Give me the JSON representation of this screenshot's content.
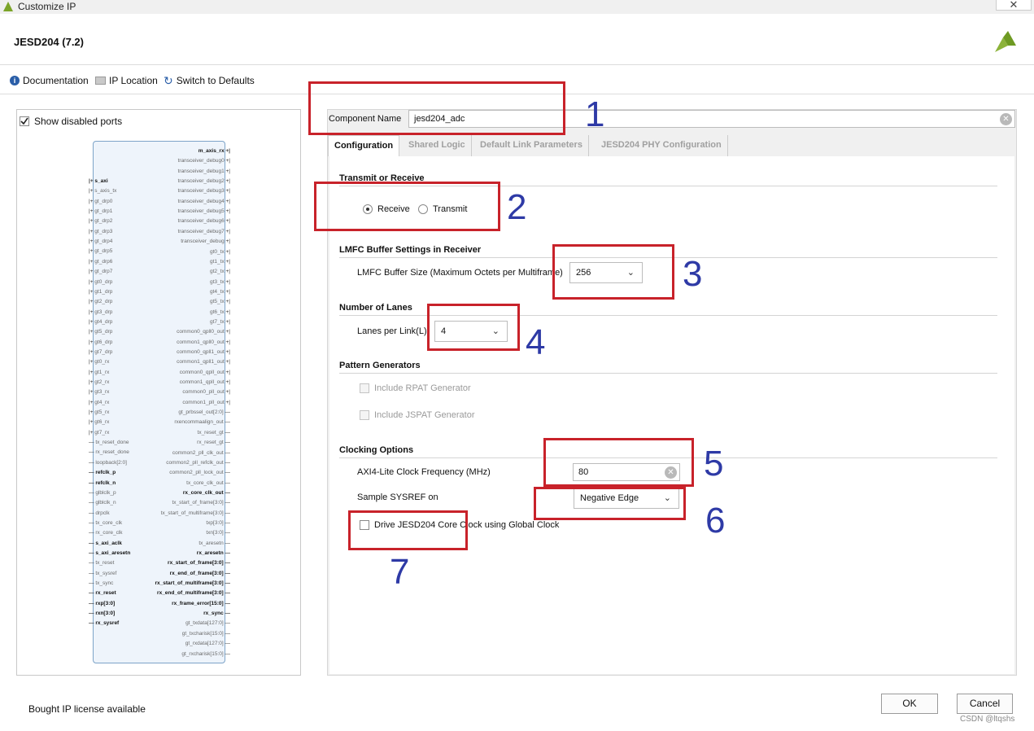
{
  "window": {
    "title": "Customize IP",
    "close_glyph": "✕"
  },
  "header": {
    "ip_name": "JESD204 (7.2)"
  },
  "toolbar": {
    "documentation": "Documentation",
    "ip_location": "IP Location",
    "switch_defaults": "Switch to Defaults"
  },
  "left_panel": {
    "show_disabled_ports": "Show disabled ports",
    "left_ports": [
      "s_axi",
      "s_axis_tx",
      "gt_drp0",
      "gt_drp1",
      "gt_drp2",
      "gt_drp3",
      "gt_drp4",
      "gt_drp5",
      "gt_drp6",
      "gt_drp7",
      "gt0_drp",
      "gt1_drp",
      "gt2_drp",
      "gt3_drp",
      "gt4_drp",
      "gt5_drp",
      "gt6_drp",
      "gt7_drp",
      "gt0_rx",
      "gt1_rx",
      "gt2_rx",
      "gt3_rx",
      "gt4_rx",
      "gt5_rx",
      "gt6_rx",
      "gt7_rx",
      "tx_reset_done",
      "rx_reset_done",
      "loopback[2:0]",
      "refclk_p",
      "refclk_n",
      "glblclk_p",
      "glblclk_n",
      "drpclk",
      "tx_core_clk",
      "rx_core_clk",
      "s_axi_aclk",
      "s_axi_aresetn",
      "tx_reset",
      "tx_sysref",
      "tx_sync",
      "rx_reset",
      "rxp[3:0]",
      "rxn[3:0]",
      "rx_sysref"
    ],
    "right_ports": [
      "m_axis_rx",
      "transceiver_debug0",
      "transceiver_debug1",
      "transceiver_debug2",
      "transceiver_debug3",
      "transceiver_debug4",
      "transceiver_debug5",
      "transceiver_debug6",
      "transceiver_debug7",
      "transceiver_debug",
      "gt0_tx",
      "gt1_tx",
      "gt2_tx",
      "gt3_tx",
      "gt4_tx",
      "gt5_tx",
      "gt6_tx",
      "gt7_tx",
      "common0_qpll0_out",
      "common1_qpll0_out",
      "common0_qpll1_out",
      "common1_qpll1_out",
      "common0_qpll_out",
      "common1_qpll_out",
      "common0_pll_out",
      "common1_pll_out",
      "gt_prbssel_out[2:0]",
      "rxencommaalign_out",
      "tx_reset_gt",
      "rx_reset_gt",
      "common2_pll_clk_out",
      "common2_pll_refclk_out",
      "common2_pll_lock_out",
      "tx_core_clk_out",
      "rx_core_clk_out",
      "tx_start_of_frame[3:0]",
      "tx_start_of_multiframe[3:0]",
      "txp[3:0]",
      "txn[3:0]",
      "tx_aresetn",
      "rx_aresetn",
      "rx_start_of_frame[3:0]",
      "rx_end_of_frame[3:0]",
      "rx_start_of_multiframe[3:0]",
      "rx_end_of_multiframe[3:0]",
      "rx_frame_error[15:0]",
      "rx_sync",
      "gt_txdata[127:0]",
      "gt_txcharisk[15:0]",
      "gt_rxdata[127:0]",
      "gt_rxcharisk[15:0]"
    ]
  },
  "component_name": {
    "label": "Component Name",
    "value": "jesd204_adc"
  },
  "tabs": [
    "Configuration",
    "Shared Logic",
    "Default Link Parameters",
    "JESD204 PHY Configuration"
  ],
  "transmit_or_receive": {
    "title": "Transmit or Receive",
    "receive": "Receive",
    "transmit": "Transmit",
    "selected": "Receive"
  },
  "lmfc": {
    "title": "LMFC Buffer Settings in Receiver",
    "label": "LMFC Buffer Size (Maximum Octets per Multiframe)",
    "value": "256"
  },
  "lanes": {
    "title": "Number of Lanes",
    "label": "Lanes per Link(L)",
    "value": "4"
  },
  "pattern": {
    "title": "Pattern Generators",
    "rpat": "Include RPAT Generator",
    "jspat": "Include JSPAT Generator"
  },
  "clocking": {
    "title": "Clocking Options",
    "axi_label": "AXI4-Lite Clock Frequency (MHz)",
    "axi_value": "80",
    "sysref_label": "Sample SYSREF on",
    "sysref_value": "Negative Edge",
    "drive_label": "Drive JESD204 Core Clock using Global Clock"
  },
  "annotations": [
    "1",
    "2",
    "3",
    "4",
    "5",
    "6",
    "7"
  ],
  "footer": {
    "license": "Bought IP license available",
    "ok": "OK",
    "cancel": "Cancel",
    "watermark": "CSDN @ltqshs"
  },
  "colors": {
    "annotation_box": "#c8222a",
    "annotation_number": "#2e3aa6"
  }
}
